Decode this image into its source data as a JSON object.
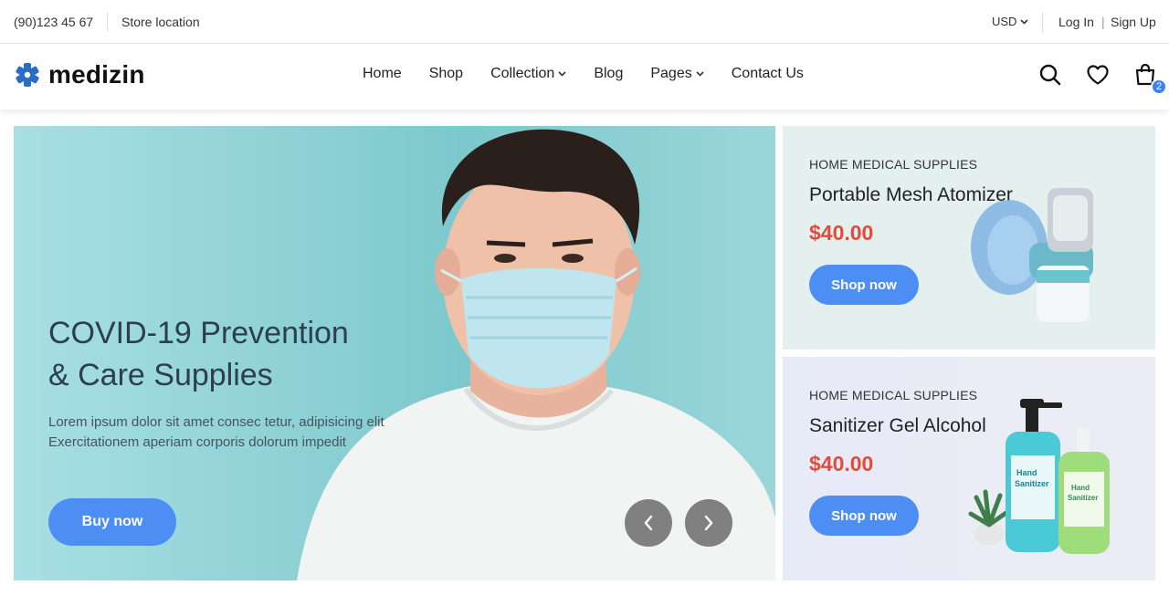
{
  "topbar": {
    "phone": "(90)123 45 67",
    "store_location": "Store location",
    "currency": "USD",
    "login": "Log In",
    "separator": "|",
    "signup": "Sign Up"
  },
  "header": {
    "logo_text": "medizin",
    "nav": [
      {
        "label": "Home",
        "has_caret": false
      },
      {
        "label": "Shop",
        "has_caret": false
      },
      {
        "label": "Collection",
        "has_caret": true
      },
      {
        "label": "Blog",
        "has_caret": false
      },
      {
        "label": "Pages",
        "has_caret": true
      },
      {
        "label": "Contact Us",
        "has_caret": false
      }
    ],
    "icons": [
      "search-icon",
      "heart-icon",
      "cart-icon"
    ],
    "cart_count": "2"
  },
  "hero": {
    "title_line1": "COVID-19 Prevention",
    "title_line2": "& Care Supplies",
    "description": "Lorem ipsum dolor sit amet consec tetur, adipisicing elit Exercitationem aperiam corporis dolorum impedit",
    "button": "Buy now"
  },
  "banners": [
    {
      "category": "HOME MEDICAL SUPPLIES",
      "title": "Portable Mesh Atomizer",
      "price": "$40.00",
      "button": "Shop now"
    },
    {
      "category": "HOME MEDICAL SUPPLIES",
      "title": "Sanitizer Gel Alcohol",
      "price": "$40.00",
      "button": "Shop now",
      "bottle_label_line1": "Hand",
      "bottle_label_line2": "Sanitizer"
    }
  ],
  "colors": {
    "accent": "#4d8ef5",
    "price": "#e34a3b",
    "logo": "#2b6cc4"
  }
}
